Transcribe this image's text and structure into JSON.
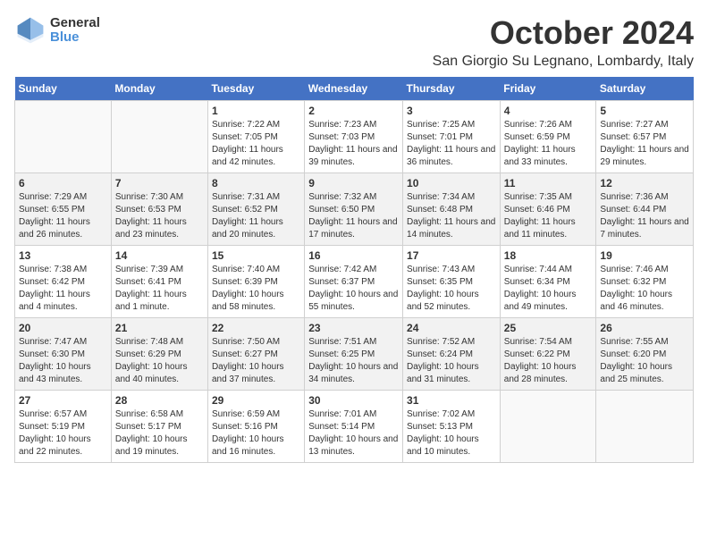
{
  "header": {
    "logo_general": "General",
    "logo_blue": "Blue",
    "month_title": "October 2024",
    "location": "San Giorgio Su Legnano, Lombardy, Italy"
  },
  "weekdays": [
    "Sunday",
    "Monday",
    "Tuesday",
    "Wednesday",
    "Thursday",
    "Friday",
    "Saturday"
  ],
  "weeks": [
    [
      {
        "day": "",
        "content": ""
      },
      {
        "day": "",
        "content": ""
      },
      {
        "day": "1",
        "content": "Sunrise: 7:22 AM\nSunset: 7:05 PM\nDaylight: 11 hours and 42 minutes."
      },
      {
        "day": "2",
        "content": "Sunrise: 7:23 AM\nSunset: 7:03 PM\nDaylight: 11 hours and 39 minutes."
      },
      {
        "day": "3",
        "content": "Sunrise: 7:25 AM\nSunset: 7:01 PM\nDaylight: 11 hours and 36 minutes."
      },
      {
        "day": "4",
        "content": "Sunrise: 7:26 AM\nSunset: 6:59 PM\nDaylight: 11 hours and 33 minutes."
      },
      {
        "day": "5",
        "content": "Sunrise: 7:27 AM\nSunset: 6:57 PM\nDaylight: 11 hours and 29 minutes."
      }
    ],
    [
      {
        "day": "6",
        "content": "Sunrise: 7:29 AM\nSunset: 6:55 PM\nDaylight: 11 hours and 26 minutes."
      },
      {
        "day": "7",
        "content": "Sunrise: 7:30 AM\nSunset: 6:53 PM\nDaylight: 11 hours and 23 minutes."
      },
      {
        "day": "8",
        "content": "Sunrise: 7:31 AM\nSunset: 6:52 PM\nDaylight: 11 hours and 20 minutes."
      },
      {
        "day": "9",
        "content": "Sunrise: 7:32 AM\nSunset: 6:50 PM\nDaylight: 11 hours and 17 minutes."
      },
      {
        "day": "10",
        "content": "Sunrise: 7:34 AM\nSunset: 6:48 PM\nDaylight: 11 hours and 14 minutes."
      },
      {
        "day": "11",
        "content": "Sunrise: 7:35 AM\nSunset: 6:46 PM\nDaylight: 11 hours and 11 minutes."
      },
      {
        "day": "12",
        "content": "Sunrise: 7:36 AM\nSunset: 6:44 PM\nDaylight: 11 hours and 7 minutes."
      }
    ],
    [
      {
        "day": "13",
        "content": "Sunrise: 7:38 AM\nSunset: 6:42 PM\nDaylight: 11 hours and 4 minutes."
      },
      {
        "day": "14",
        "content": "Sunrise: 7:39 AM\nSunset: 6:41 PM\nDaylight: 11 hours and 1 minute."
      },
      {
        "day": "15",
        "content": "Sunrise: 7:40 AM\nSunset: 6:39 PM\nDaylight: 10 hours and 58 minutes."
      },
      {
        "day": "16",
        "content": "Sunrise: 7:42 AM\nSunset: 6:37 PM\nDaylight: 10 hours and 55 minutes."
      },
      {
        "day": "17",
        "content": "Sunrise: 7:43 AM\nSunset: 6:35 PM\nDaylight: 10 hours and 52 minutes."
      },
      {
        "day": "18",
        "content": "Sunrise: 7:44 AM\nSunset: 6:34 PM\nDaylight: 10 hours and 49 minutes."
      },
      {
        "day": "19",
        "content": "Sunrise: 7:46 AM\nSunset: 6:32 PM\nDaylight: 10 hours and 46 minutes."
      }
    ],
    [
      {
        "day": "20",
        "content": "Sunrise: 7:47 AM\nSunset: 6:30 PM\nDaylight: 10 hours and 43 minutes."
      },
      {
        "day": "21",
        "content": "Sunrise: 7:48 AM\nSunset: 6:29 PM\nDaylight: 10 hours and 40 minutes."
      },
      {
        "day": "22",
        "content": "Sunrise: 7:50 AM\nSunset: 6:27 PM\nDaylight: 10 hours and 37 minutes."
      },
      {
        "day": "23",
        "content": "Sunrise: 7:51 AM\nSunset: 6:25 PM\nDaylight: 10 hours and 34 minutes."
      },
      {
        "day": "24",
        "content": "Sunrise: 7:52 AM\nSunset: 6:24 PM\nDaylight: 10 hours and 31 minutes."
      },
      {
        "day": "25",
        "content": "Sunrise: 7:54 AM\nSunset: 6:22 PM\nDaylight: 10 hours and 28 minutes."
      },
      {
        "day": "26",
        "content": "Sunrise: 7:55 AM\nSunset: 6:20 PM\nDaylight: 10 hours and 25 minutes."
      }
    ],
    [
      {
        "day": "27",
        "content": "Sunrise: 6:57 AM\nSunset: 5:19 PM\nDaylight: 10 hours and 22 minutes."
      },
      {
        "day": "28",
        "content": "Sunrise: 6:58 AM\nSunset: 5:17 PM\nDaylight: 10 hours and 19 minutes."
      },
      {
        "day": "29",
        "content": "Sunrise: 6:59 AM\nSunset: 5:16 PM\nDaylight: 10 hours and 16 minutes."
      },
      {
        "day": "30",
        "content": "Sunrise: 7:01 AM\nSunset: 5:14 PM\nDaylight: 10 hours and 13 minutes."
      },
      {
        "day": "31",
        "content": "Sunrise: 7:02 AM\nSunset: 5:13 PM\nDaylight: 10 hours and 10 minutes."
      },
      {
        "day": "",
        "content": ""
      },
      {
        "day": "",
        "content": ""
      }
    ]
  ]
}
